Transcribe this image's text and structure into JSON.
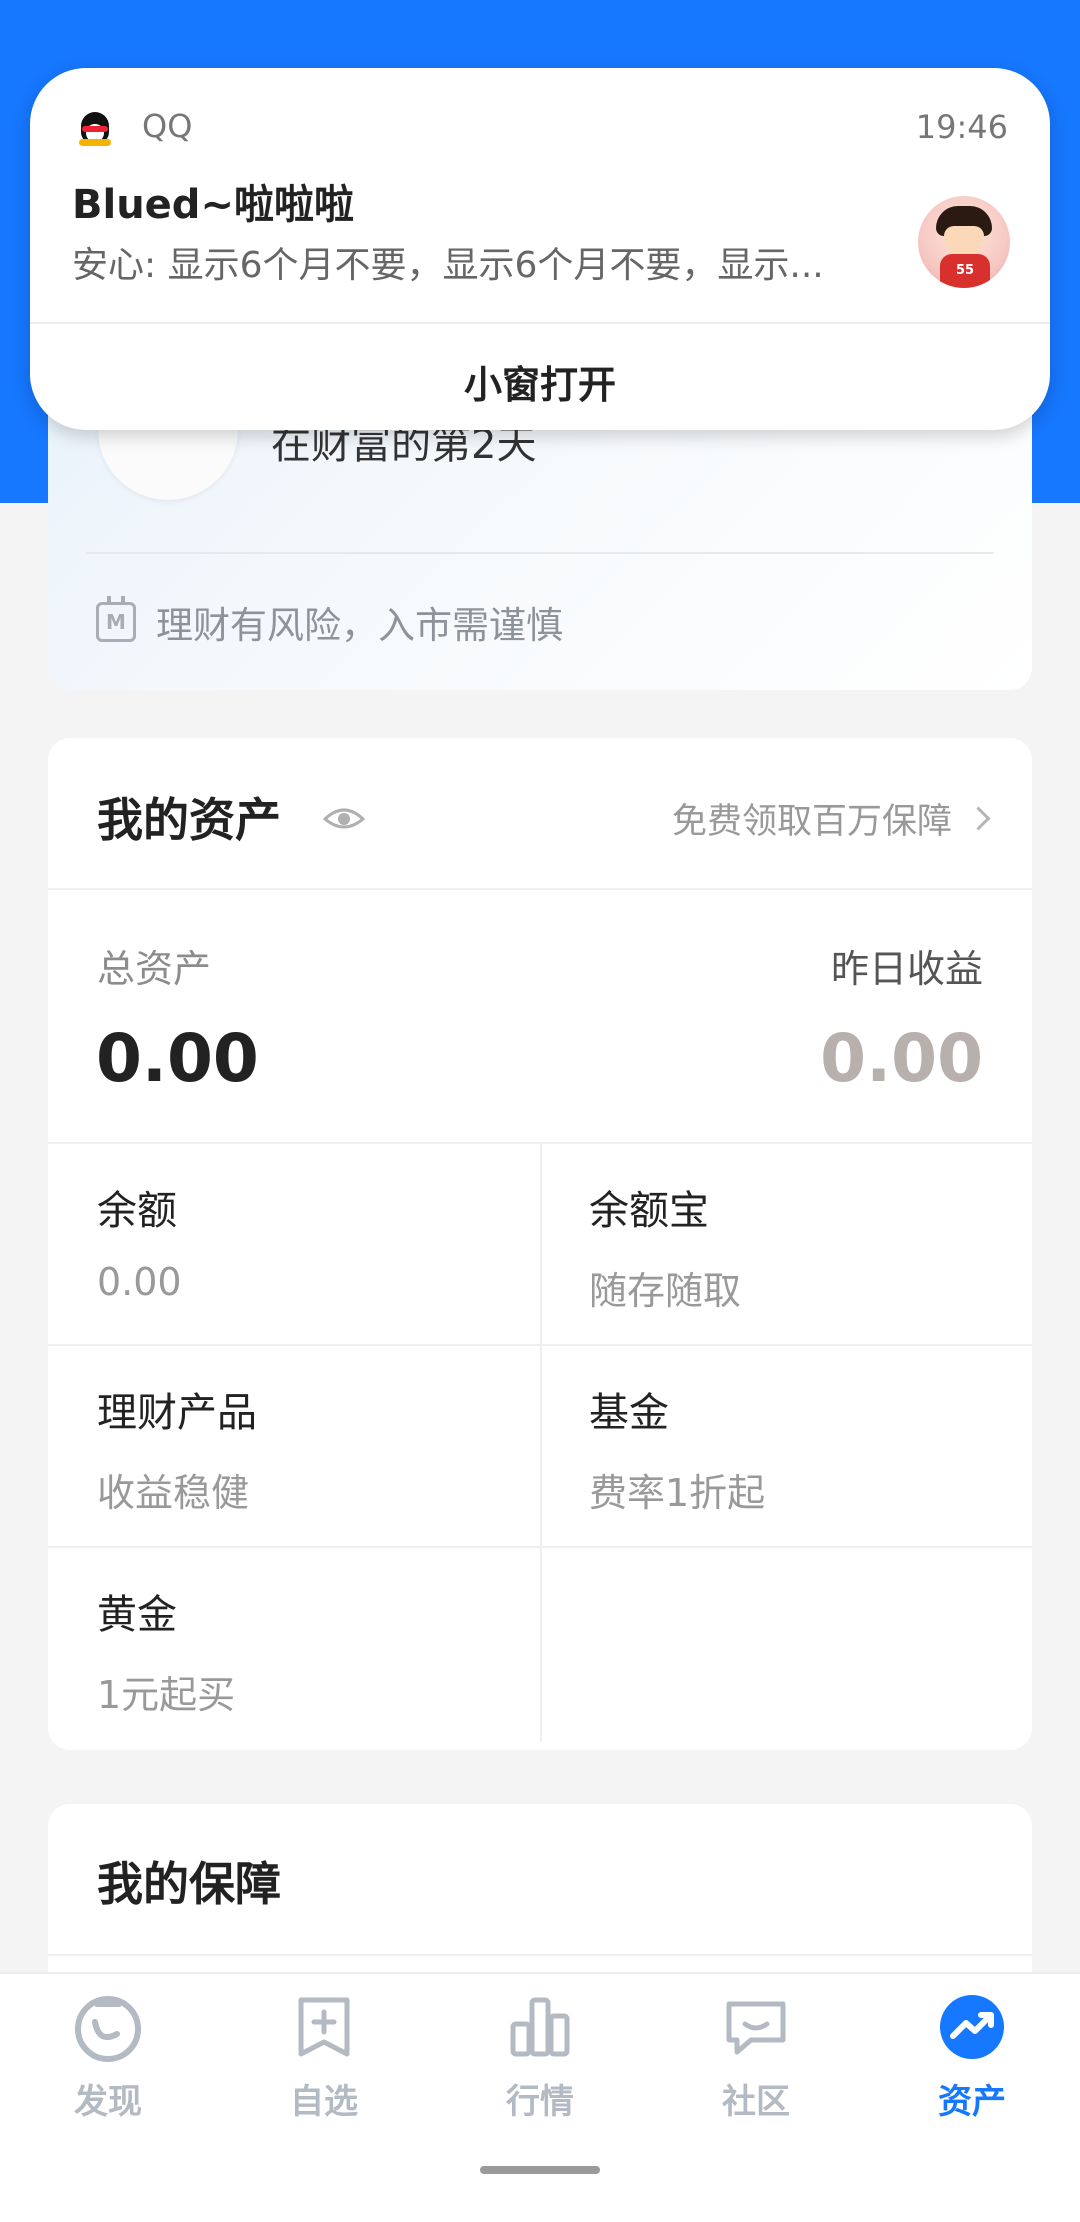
{
  "notification": {
    "app_name": "QQ",
    "time": "19:46",
    "title": "Blued~啦啦啦",
    "message": "安心: 显示6个月不要，显示6个月不要，显示...",
    "action_label": "小窗打开",
    "avatar_shirt_number": "55"
  },
  "top_card": {
    "days_text": "在财富的第2天",
    "risk_icon_letter": "M",
    "risk_text": "理财有风险，入市需谨慎"
  },
  "assets": {
    "title": "我的资产",
    "guarantee_link": "免费领取百万保障",
    "total_label": "总资产",
    "total_value": "0.00",
    "yesterday_label": "昨日收益",
    "yesterday_value": "0.00",
    "items": [
      {
        "name": "余额",
        "desc": "0.00"
      },
      {
        "name": "余额宝",
        "desc": "随存随取"
      },
      {
        "name": "理财产品",
        "desc": "收益稳健"
      },
      {
        "name": "基金",
        "desc": "费率1折起"
      },
      {
        "name": "黄金",
        "desc": "1元起买"
      }
    ]
  },
  "guarantee": {
    "title": "我的保障"
  },
  "nav": {
    "items": [
      {
        "label": "发现",
        "icon": "discover-icon"
      },
      {
        "label": "自选",
        "icon": "watchlist-icon"
      },
      {
        "label": "行情",
        "icon": "market-chart-icon"
      },
      {
        "label": "社区",
        "icon": "community-chat-icon"
      },
      {
        "label": "资产",
        "icon": "assets-trend-icon"
      }
    ],
    "active_index": 4
  },
  "colors": {
    "brand_blue": "#1677ff",
    "nav_inactive": "#b3bac3"
  }
}
